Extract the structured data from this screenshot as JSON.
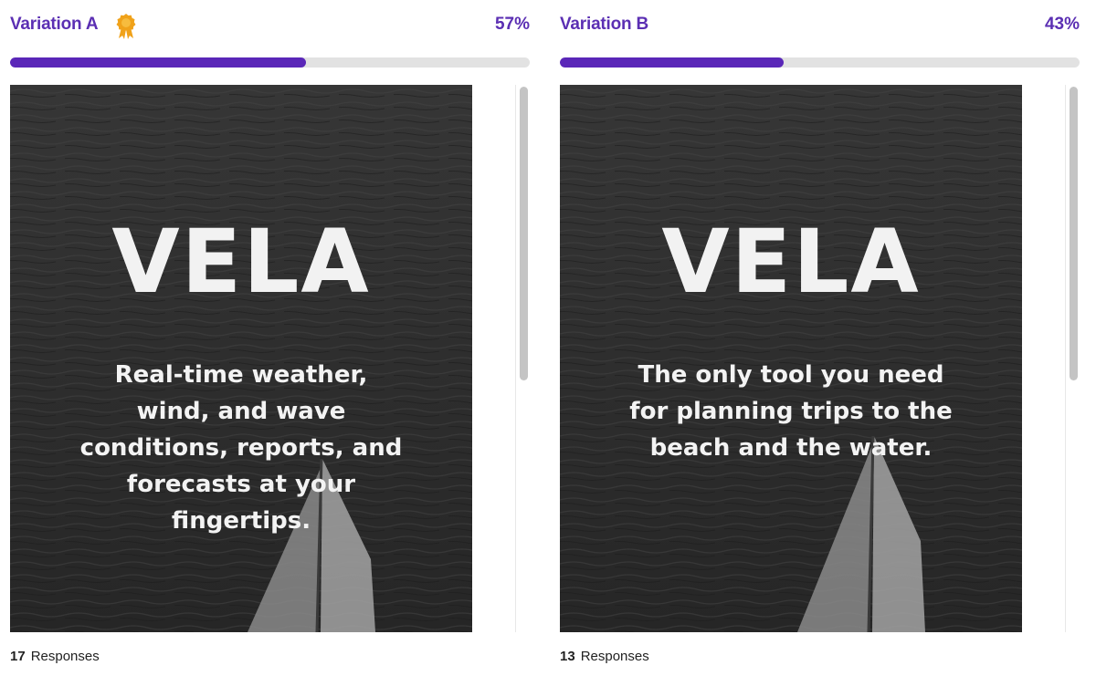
{
  "variations": [
    {
      "title": "Variation A",
      "percent_label": "57%",
      "progress_fraction": 0.57,
      "winner": true,
      "winner_icon": "award-ribbon-icon",
      "ad": {
        "brand": "VELA",
        "tagline_lines": [
          "Real-time weather,",
          "wind, and wave",
          "conditions, reports, and",
          "forecasts at your",
          "fingertips."
        ]
      },
      "responses_count": "17",
      "responses_label": "Responses"
    },
    {
      "title": "Variation B",
      "percent_label": "43%",
      "progress_fraction": 0.43,
      "winner": false,
      "ad": {
        "brand": "VELA",
        "tagline_lines": [
          "The only tool you need",
          "for planning trips to the",
          "beach and the water."
        ]
      },
      "responses_count": "13",
      "responses_label": "Responses"
    }
  ],
  "colors": {
    "accent": "#5b2fb3",
    "progress_fill": "#5a27b8",
    "progress_track": "#e2e2e2",
    "badge": "#f0a21a"
  }
}
